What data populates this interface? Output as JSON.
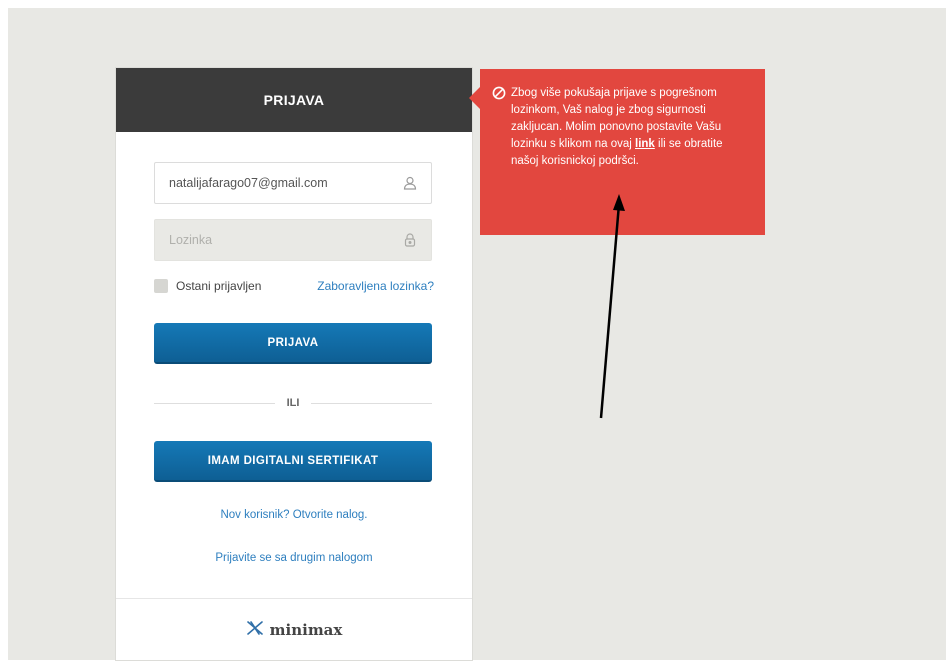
{
  "login_card": {
    "title": "PRIJAVA",
    "email": {
      "value": "natalijafarago07@gmail.com",
      "icon": "user-icon"
    },
    "password": {
      "placeholder": "Lozinka",
      "icon": "lock-icon"
    },
    "remember_label": "Ostani prijavljen",
    "forgot_link": "Zaboravljena lozinka?",
    "login_button": "PRIJAVA",
    "divider_text": "ILI",
    "certificate_button": "IMAM DIGITALNI SERTIFIKAT",
    "new_user_link": "Nov korisnik? Otvorite nalog.",
    "other_account_link": "Prijavite se sa drugim nalogom",
    "footer_logo": "minimax"
  },
  "alert": {
    "icon": "prohibited-icon",
    "text_before": "Zbog više pokušaja prijave s pogrešnom lozinkom, Vaš nalog je zbog sigurnosti zakljucan. Molim ponovno postavite Vašu lozinku s klikom na ovaj ",
    "link_text": "link",
    "text_after": " ili se obratite našoj korisnickoj podršci.",
    "background_color": "#e2473f"
  },
  "colors": {
    "header_bg": "#3b3b3b",
    "button_blue": "#1579b7",
    "link_blue": "#2e7fbf",
    "page_bg": "#e8e8e4"
  }
}
